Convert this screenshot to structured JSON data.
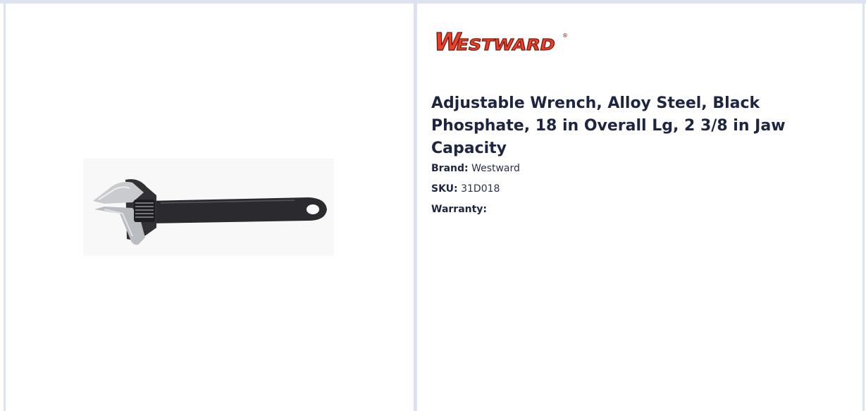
{
  "brand_logo": {
    "text": "WESTWARD",
    "registered_mark": "®",
    "colors": {
      "fill": "#e8412a",
      "outline": "#7b1a10"
    }
  },
  "product": {
    "title": "Adjustable Wrench, Alloy Steel, Black Phosphate, 18 in Overall Lg, 2 3/8 in Jaw Capacity",
    "image": {
      "icon": "adjustable-wrench-image",
      "colors": {
        "head": "#c7c9cc",
        "handle": "#2b2b2f"
      }
    },
    "specs": [
      {
        "key": "Brand:",
        "value": "Westward"
      },
      {
        "key": "SKU:",
        "value": "31D018"
      },
      {
        "key": "Warranty:",
        "value": ""
      }
    ]
  },
  "colors": {
    "border": "#dde3ee",
    "title_text": "#1d2541"
  }
}
